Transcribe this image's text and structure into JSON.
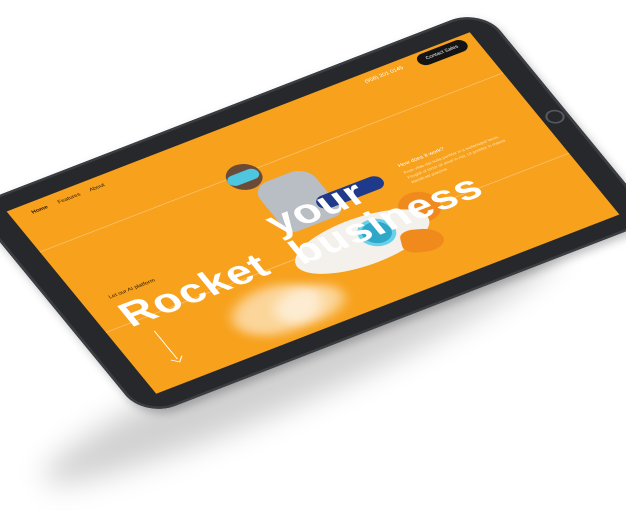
{
  "nav": {
    "items": [
      {
        "label": "Home"
      },
      {
        "label": "Features"
      },
      {
        "label": "About"
      }
    ],
    "phone": "(956) 201 0145",
    "contact_label": "Contact Sales"
  },
  "hero": {
    "tagline": "Let our AI platform",
    "headline_line1": "Rocket",
    "headline_line2": "your business",
    "how_title": "How does it work?",
    "how_text": "Proin vitae nisi nulla porttitor in a scelerisque lacus. Feugiat ut tortor sit amet in nisi. Ut porttitor in massa blandit elit placerat."
  },
  "colors": {
    "screen_bg": "#f7a11c",
    "device_body": "#26282b",
    "button_bg": "#141414"
  },
  "icons": {
    "scroll_indicator": "arrow-down-icon",
    "home_button": "home-button-icon"
  }
}
